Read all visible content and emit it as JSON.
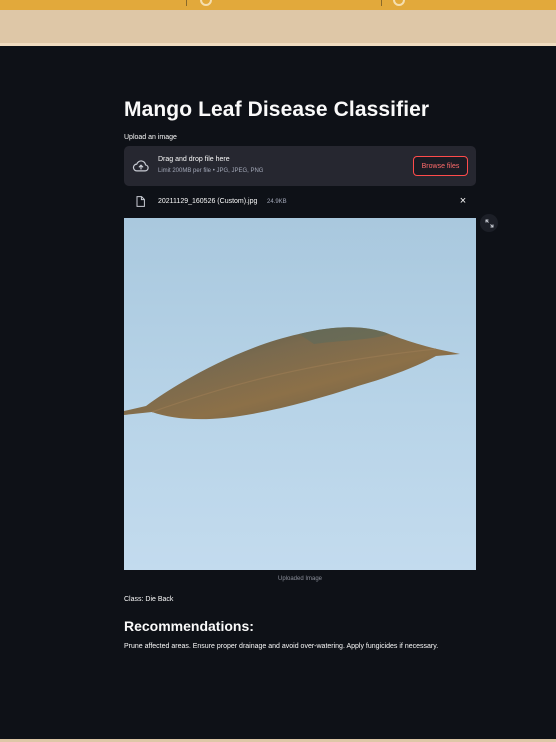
{
  "page": {
    "title": "Mango Leaf Disease Classifier"
  },
  "uploader": {
    "label": "Upload an image",
    "drop_title": "Drag and drop file here",
    "drop_subtitle": "Limit 200MB per file • JPG, JPEG, PNG",
    "browse_label": "Browse files",
    "file_name": "20211129_160526 (Custom).jpg",
    "file_size": "24.9KB",
    "remove_label": "×"
  },
  "image": {
    "caption": "Uploaded Image"
  },
  "result": {
    "class_text": "Class: Die Back",
    "recommendations_heading": "Recommendations:",
    "recommendations_text": "Prune affected areas. Ensure proper drainage and avoid over-watering. Apply fungicides if necessary."
  },
  "colors": {
    "background": "#0e1117",
    "accent": "#ff4b4b",
    "top_bar": "#e2a93b",
    "band": "#dec7a7"
  },
  "icons": {
    "upload": "cloud-upload-icon",
    "file": "file-icon",
    "close": "close-icon",
    "fullscreen": "fullscreen-icon"
  }
}
